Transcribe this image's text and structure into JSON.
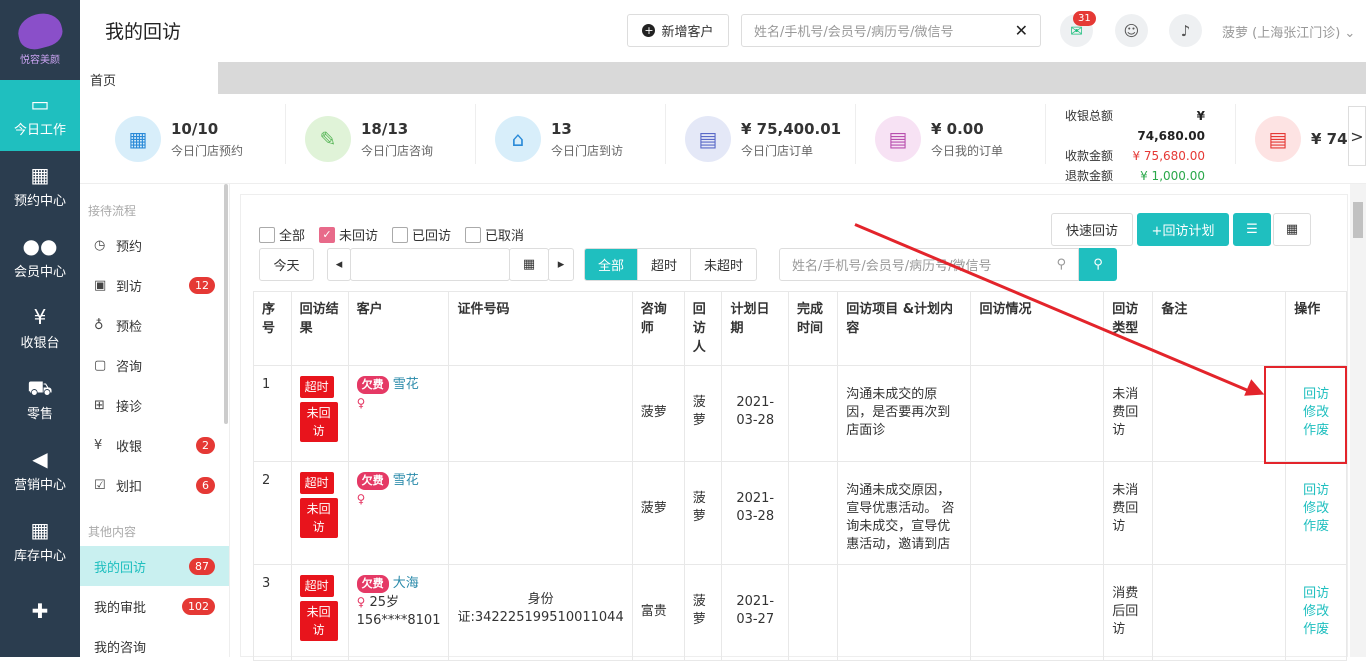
{
  "nav": {
    "brand": "悦容美颜",
    "items": [
      {
        "label": "今日工作",
        "icon": "laptop-icon"
      },
      {
        "label": "预约中心",
        "icon": "calendar-icon"
      },
      {
        "label": "会员中心",
        "icon": "users-icon"
      },
      {
        "label": "收银台",
        "icon": "yen-icon"
      },
      {
        "label": "零售",
        "icon": "cart-icon"
      },
      {
        "label": "营销中心",
        "icon": "megaphone-icon"
      },
      {
        "label": "库存中心",
        "icon": "grid-icon"
      }
    ]
  },
  "header": {
    "title": "我的回访",
    "new_customer": "新增客户",
    "search_placeholder": "姓名/手机号/会员号/病历号/微信号",
    "notice_count": "31",
    "user": "菠萝 (上海张江门诊)"
  },
  "tabs": {
    "home": "首页"
  },
  "stats": [
    {
      "value": "10/10",
      "label": "今日门店预约"
    },
    {
      "value": "18/13",
      "label": "今日门店咨询"
    },
    {
      "value": "13",
      "label": "今日门店到访"
    },
    {
      "value": "¥ 75,400.01",
      "label": "今日门店订单"
    },
    {
      "value": "¥ 0.00",
      "label": "今日我的订单"
    }
  ],
  "totals": {
    "total_label": "收银总额",
    "total_value": "¥ 74,680.00",
    "received_label": "收款金额",
    "received_value": "¥ 75,680.00",
    "refund_label": "退款金额",
    "refund_value": "¥ 1,000.00",
    "next_value": "¥ 74"
  },
  "sidebar": {
    "section1": "接待流程",
    "section2": "其他内容",
    "items": [
      {
        "label": "预约",
        "icon": "clock-icon",
        "count": ""
      },
      {
        "label": "到访",
        "icon": "id-card-icon",
        "count": "12"
      },
      {
        "label": "预检",
        "icon": "stethoscope-icon",
        "count": ""
      },
      {
        "label": "咨询",
        "icon": "chat-icon",
        "count": ""
      },
      {
        "label": "接诊",
        "icon": "medkit-icon",
        "count": ""
      },
      {
        "label": "收银",
        "icon": "yen-circle-icon",
        "count": "2"
      },
      {
        "label": "划扣",
        "icon": "check-square-icon",
        "count": "6"
      }
    ],
    "other": [
      {
        "label": "我的回访",
        "count": "87"
      },
      {
        "label": "我的审批",
        "count": "102"
      },
      {
        "label": "我的咨询",
        "count": ""
      }
    ]
  },
  "filters": {
    "all": "全部",
    "unvisited": "未回访",
    "visited": "已回访",
    "cancelled": "已取消",
    "today": "今天",
    "seg_all": "全部",
    "seg_timeout": "超时",
    "seg_not_timeout": "未超时",
    "search_placeholder": "姓名/手机号/会员号/病历号/微信号",
    "quick": "快速回访",
    "plan": "+回访计划"
  },
  "table": {
    "headers": [
      "序号",
      "回访结果",
      "客户",
      "证件号码",
      "咨询师",
      "回访人",
      "计划日期",
      "完成时间",
      "回访项目 &计划内容",
      "回访情况",
      "回访类型",
      "备注",
      "操作"
    ],
    "rows": [
      {
        "no": "1",
        "tag1": "超时",
        "tag2": "未回访",
        "badge": "欠费",
        "name": "雪花",
        "extra": "",
        "idno": "",
        "consultant": "菠萝",
        "visitor": "菠萝",
        "date": "2021-03-28",
        "content": "沟通未成交的原因，是否要再次到店面诊",
        "type": "未消费回访",
        "ops": [
          "回访",
          "修改",
          "作废"
        ]
      },
      {
        "no": "2",
        "tag1": "超时",
        "tag2": "未回访",
        "badge": "欠费",
        "name": "雪花",
        "extra": "",
        "idno": "",
        "consultant": "菠萝",
        "visitor": "菠萝",
        "date": "2021-03-28",
        "content": "沟通未成交原因，宣导优惠活动。 咨询未成交，宣导优惠活动，邀请到店",
        "type": "未消费回访",
        "ops": [
          "回访",
          "修改",
          "作废"
        ]
      },
      {
        "no": "3",
        "tag1": "超时",
        "tag2": "未回访",
        "badge": "欠费",
        "name": "大海",
        "extra": "25岁 156****8101",
        "idno": "身份证:342225199510011044",
        "consultant": "富贵",
        "visitor": "菠萝",
        "date": "2021-03-27",
        "content": "",
        "type": "消费后回访",
        "ops": [
          "回访",
          "修改",
          "作废"
        ]
      }
    ]
  }
}
